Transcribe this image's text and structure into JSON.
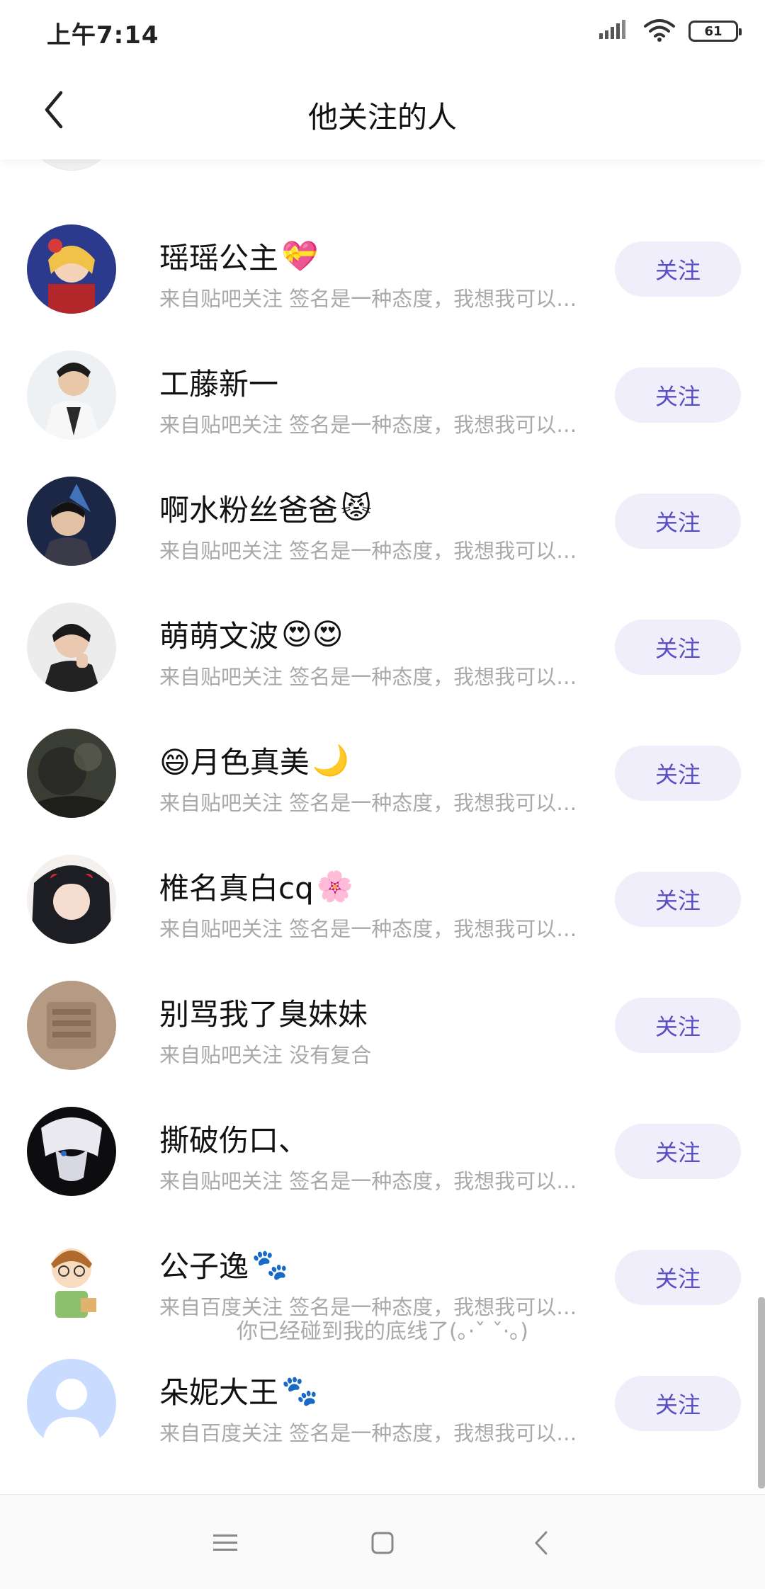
{
  "status_bar": {
    "time": "上午7:14",
    "battery": "61"
  },
  "header": {
    "title": "他关注的人"
  },
  "follow_label": "关注",
  "users": [
    {
      "name": "瑶瑶公主",
      "emoji": "💝",
      "subtitle": "来自贴吧关注 签名是一种态度，我想我可以…"
    },
    {
      "name": "工藤新一",
      "emoji": "",
      "subtitle": "来自贴吧关注 签名是一种态度，我想我可以…"
    },
    {
      "name": "啊水粉丝爸爸",
      "emoji": "😾",
      "subtitle": "来自贴吧关注 签名是一种态度，我想我可以…"
    },
    {
      "name": "萌萌文波",
      "emoji": "😍😍",
      "subtitle": "来自贴吧关注 签名是一种态度，我想我可以…"
    },
    {
      "name": "😄月色真美",
      "emoji": "🌙",
      "subtitle": "来自贴吧关注 签名是一种态度，我想我可以…"
    },
    {
      "name": "椎名真白cq",
      "emoji": "🌸",
      "subtitle": "来自贴吧关注 签名是一种态度，我想我可以…"
    },
    {
      "name": "别骂我了臭妹妹",
      "emoji": "",
      "subtitle": "来自贴吧关注 没有复合"
    },
    {
      "name": "撕破伤口、",
      "emoji": "",
      "subtitle": "来自贴吧关注 签名是一种态度，我想我可以…"
    },
    {
      "name": "公子逸",
      "emoji": "🐾",
      "subtitle": "来自百度关注 签名是一种态度，我想我可以…"
    },
    {
      "name": "朵妮大王",
      "emoji": "🐾",
      "subtitle": "来自百度关注 签名是一种态度，我想我可以…"
    }
  ],
  "footer_note": "你已经碰到我的底线了(｡·ˇ ˇ·｡)",
  "nav": {
    "menu_icon": "menu-icon",
    "home_icon": "square-home-icon",
    "back_icon": "triangle-back-icon"
  }
}
